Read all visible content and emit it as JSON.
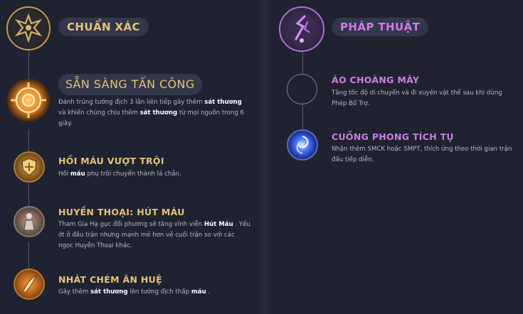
{
  "left_tree": {
    "title": "CHUẨN XÁC",
    "keystone": {
      "name": "SẴN SÀNG TẤN CÔNG",
      "desc": [
        {
          "t": "Đánh trúng tướng địch 3 lần liên tiếp gây thêm "
        },
        {
          "t": "sát thương",
          "b": true
        },
        {
          "t": " và khiến chúng chịu thêm "
        },
        {
          "t": "sát thương",
          "b": true
        },
        {
          "t": " từ mọi nguồn trong 6 giây."
        }
      ]
    },
    "runes": [
      {
        "name": "HỒI  MÁU  VƯỢT TRỘI",
        "icon": "shield-heal-icon",
        "desc": [
          {
            "t": "Hồi  "
          },
          {
            "t": "máu",
            "b": true
          },
          {
            "t": "  phụ trội chuyển thành lá chắn."
          }
        ]
      },
      {
        "name": "HUYỀN THOẠI:  HÚT MÁU",
        "icon": "legend-statue-icon",
        "desc": [
          {
            "t": "Tham Gia Hạ gục đối phương sẽ tăng vĩnh viễn "
          },
          {
            "t": "Hút  Máu",
            "b": true
          },
          {
            "t": " . Yếu ớt ở đầu trận nhưng mạnh mẽ hơn về cuối trận so với các ngọc Huyền Thoại khác."
          }
        ]
      },
      {
        "name": "NHÁT CHÉM ÂN HUỆ",
        "icon": "blade-slash-icon",
        "desc": [
          {
            "t": "Gây thêm  "
          },
          {
            "t": "sát thương",
            "b": true
          },
          {
            "t": "  lên tướng địch thấp  "
          },
          {
            "t": "máu",
            "b": true
          },
          {
            "t": " ."
          }
        ]
      }
    ]
  },
  "right_tree": {
    "title": "PHÁP THUẬT",
    "runes": [
      {
        "name": "ÁO CHOÀNG MÂY",
        "icon": "empty-slot-icon",
        "desc": [
          {
            "t": "Tăng tốc độ di chuyển và đi xuyên vật thể sau khi dùng Phép Bổ Trợ."
          }
        ]
      },
      {
        "name": "CUỒNG PHONG TÍCH TỤ",
        "icon": "wind-vortex-icon",
        "desc": [
          {
            "t": "Nhận thêm SMCK hoặc SMPT, thích ứng theo thời gian trận đấu tiếp diễn."
          }
        ]
      }
    ]
  },
  "colors": {
    "precision": "#e6c27b",
    "sorcery": "#cf7be8",
    "background": "#1f2230",
    "pill": "#33374a"
  }
}
